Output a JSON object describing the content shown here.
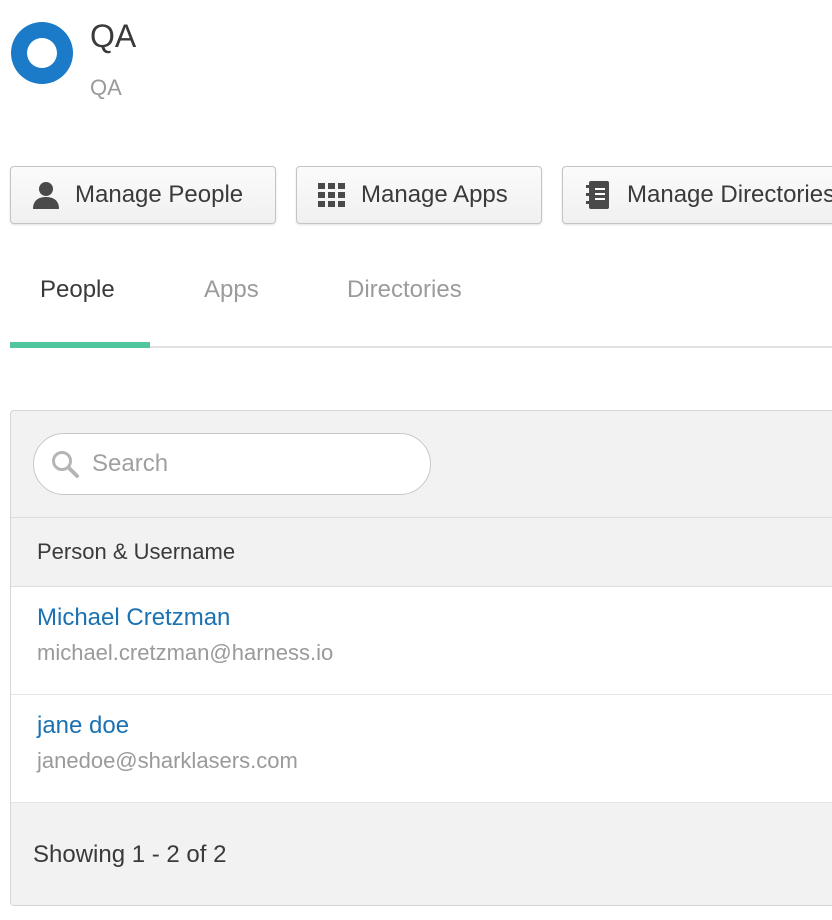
{
  "group": {
    "title": "QA",
    "subtitle": "QA",
    "logo_color": "#1b7bc8"
  },
  "actions": {
    "manage_people": {
      "label": "Manage People",
      "icon": "person-icon"
    },
    "manage_apps": {
      "label": "Manage Apps",
      "icon": "grid-icon"
    },
    "manage_directories": {
      "label": "Manage Directories",
      "icon": "address-book-icon"
    }
  },
  "tabs": [
    {
      "label": "People",
      "active": true
    },
    {
      "label": "Apps",
      "active": false
    },
    {
      "label": "Directories",
      "active": false
    }
  ],
  "accent_color": "#4fc69d",
  "search": {
    "placeholder": "Search",
    "value": ""
  },
  "table": {
    "column_header": "Person & Username",
    "rows": [
      {
        "name": "Michael Cretzman",
        "username": "michael.cretzman@harness.io"
      },
      {
        "name": "jane doe",
        "username": "janedoe@sharklasers.com"
      }
    ]
  },
  "pagination": {
    "summary": "Showing 1 - 2 of 2"
  }
}
